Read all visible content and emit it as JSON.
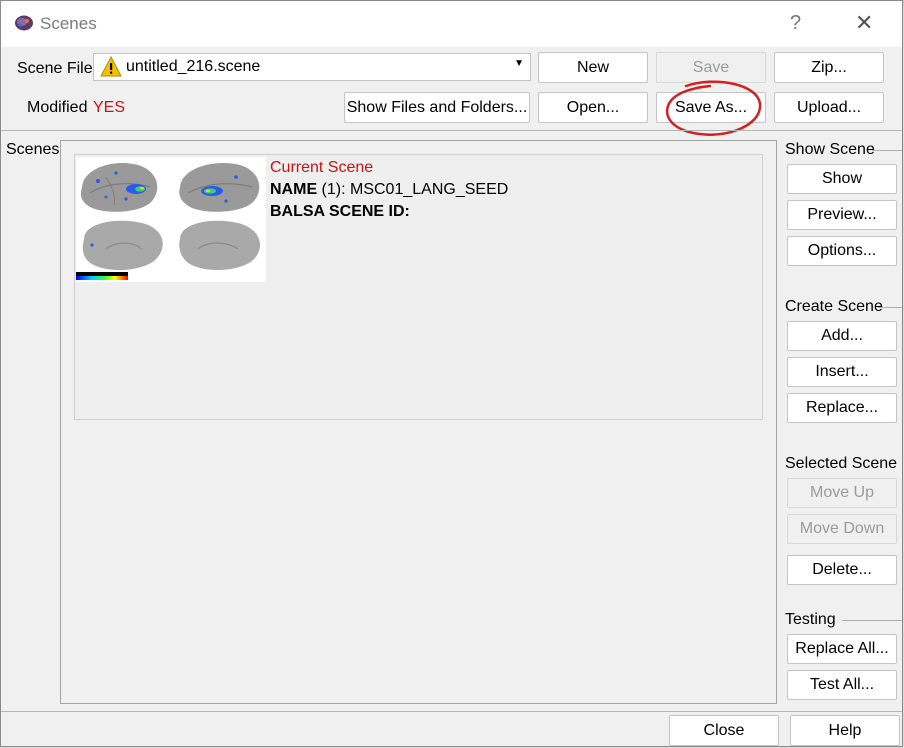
{
  "window": {
    "title": "Scenes",
    "help_glyph": "?",
    "close_glyph": "✕"
  },
  "scene_file": {
    "label": "Scene File",
    "value": "untitled_216.scene",
    "warning_icon": "warning-icon"
  },
  "modified": {
    "label": "Modified",
    "value": "YES"
  },
  "toolbar": {
    "new": "New",
    "save": "Save",
    "zip": "Zip...",
    "show_files": "Show Files and Folders...",
    "open": "Open...",
    "save_as": "Save As...",
    "upload": "Upload..."
  },
  "scenes": {
    "label": "Scenes",
    "items": [
      {
        "current_label": "Current Scene",
        "name_key": "NAME",
        "name_value": " (1): MSC01_LANG_SEED",
        "balsa_key": "BALSA SCENE ID:"
      }
    ]
  },
  "right_panel": {
    "show_scene": {
      "heading": "Show Scene",
      "show": "Show",
      "preview": "Preview...",
      "options": "Options..."
    },
    "create_scene": {
      "heading": "Create Scene",
      "add": "Add...",
      "insert": "Insert...",
      "replace": "Replace..."
    },
    "selected_scene": {
      "heading": "Selected Scene",
      "move_up": "Move Up",
      "move_down": "Move Down",
      "delete": "Delete..."
    },
    "testing": {
      "heading": "Testing",
      "replace_all": "Replace All...",
      "test_all": "Test All..."
    }
  },
  "footer": {
    "close": "Close",
    "help": "Help"
  },
  "colors": {
    "modified_accent": "#cc1111",
    "annotation_circle": "#d42020"
  }
}
